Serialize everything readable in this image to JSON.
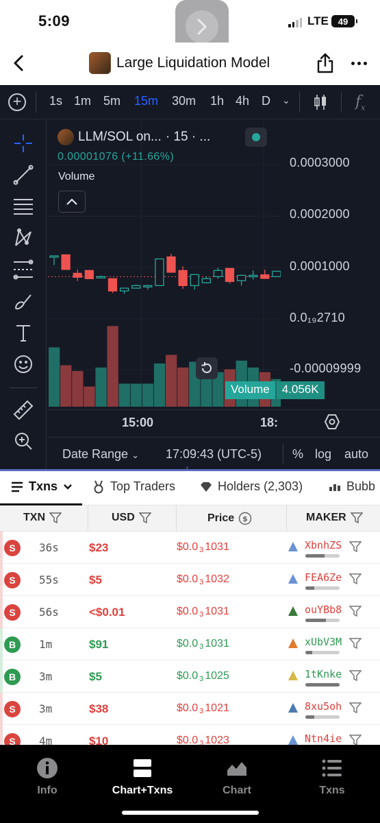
{
  "status": {
    "time": "5:09",
    "network": "LTE",
    "battery": "49"
  },
  "nav": {
    "title": "Large Liquidation Model"
  },
  "chart_toolbar": {
    "timeframes": [
      "1s",
      "1m",
      "5m",
      "15m",
      "30m",
      "1h",
      "4h",
      "D"
    ],
    "active": "15m",
    "fx_label": "f"
  },
  "legend": {
    "symbol": "LLM/SOL on...",
    "interval": "· 15 · ...",
    "price": "0.00001076 (+11.66%)",
    "volume_label": "Volume"
  },
  "price_axis": [
    "0.0003000",
    "0.0002000",
    "0.0001000",
    "0.0₁₉2710",
    "-0.00009999"
  ],
  "volume_tag": {
    "label": "Volume",
    "value": "4.056K"
  },
  "time_axis": [
    "15:00",
    "18:"
  ],
  "chart_bottom": {
    "date_range": "Date Range",
    "clock": "17:09:43 (UTC-5)",
    "percent": "%",
    "log": "log",
    "auto": "auto"
  },
  "colors": {
    "up": "#26a69a",
    "down": "#ef5350",
    "background": "#151924",
    "accent": "#2962ff"
  },
  "chart_data": {
    "type": "candlestick",
    "ylim": [
      -9.999e-05,
      0.0003
    ],
    "candles": [
      {
        "o": 0.000122,
        "h": 0.000122,
        "l": 0.000104,
        "c": 0.000122
      },
      {
        "o": 0.000124,
        "h": 0.000124,
        "l": 9.55e-05,
        "c": 9.55e-05
      },
      {
        "o": 8.8e-05,
        "h": 9.55e-05,
        "l": 7.3e-05,
        "c": 8.02e-05
      },
      {
        "o": 9.35e-05,
        "h": 9.35e-05,
        "l": 7.75e-05,
        "c": 7.75e-05
      },
      {
        "o": 8.15e-05,
        "h": 8.35e-05,
        "l": 8.15e-05,
        "c": 8.15e-05
      },
      {
        "o": 7.75e-05,
        "h": 7.75e-05,
        "l": 4.95e-05,
        "c": 5.35e-05
      },
      {
        "o": 5.35e-05,
        "h": 5.6e-05,
        "l": 4.8e-05,
        "c": 5.9e-05
      },
      {
        "o": 5.9e-05,
        "h": 6.6e-05,
        "l": 5.9e-05,
        "c": 6.4e-05
      },
      {
        "o": 6.4e-05,
        "h": 6.5e-05,
        "l": 5.6e-05,
        "c": 6.4e-05
      },
      {
        "o": 6.4e-05,
        "h": 0.000116,
        "l": 6.4e-05,
        "c": 0.000116
      },
      {
        "o": 0.00012,
        "h": 0.000126,
        "l": 9e-05,
        "c": 9e-05
      },
      {
        "o": 9.35e-05,
        "h": 0.0001015,
        "l": 5.75e-05,
        "c": 6.4e-05
      },
      {
        "o": 6.4e-05,
        "h": 8.55e-05,
        "l": 5.6e-05,
        "c": 8.55e-05
      },
      {
        "o": 6.95e-05,
        "h": 8.15e-05,
        "l": 6.8e-05,
        "c": 7.75e-05
      },
      {
        "o": 8.15e-05,
        "h": 9.9e-05,
        "l": 7.75e-05,
        "c": 9.35e-05
      },
      {
        "o": 9.75e-05,
        "h": 9.75e-05,
        "l": 6.8e-05,
        "c": 7.2e-05
      },
      {
        "o": 7.35e-05,
        "h": 8.55e-05,
        "l": 6.4e-05,
        "c": 8.4e-05
      },
      {
        "o": 8.3e-05,
        "h": 9.35e-05,
        "l": 7.6e-05,
        "c": 8.4e-05
      },
      {
        "o": 8.5e-05,
        "h": 9.5e-05,
        "l": 7.7e-05,
        "c": 7.8e-05
      },
      {
        "o": 8.15e-05,
        "h": 9.2e-05,
        "l": 8.15e-05,
        "c": 9.2e-05
      }
    ],
    "volume": [
      103,
      72,
      62,
      35,
      68,
      140,
      40,
      40,
      40,
      75,
      90,
      68,
      78,
      78,
      60,
      65,
      80,
      68,
      60,
      48
    ]
  },
  "tabs": [
    {
      "label": "Txns",
      "active": true
    },
    {
      "label": "Top Traders"
    },
    {
      "label": "Holders (2,303)"
    },
    {
      "label": "Bubb"
    }
  ],
  "table": {
    "headers": [
      "TXN",
      "USD",
      "Price",
      "MAKER"
    ],
    "rows": [
      {
        "type": "S",
        "age": "36s",
        "usd": "$23",
        "price_a": "$0.0",
        "price_sub": "3",
        "price_b": "1031",
        "maker": "XbnhZS",
        "bar": 0.55,
        "icon": "#6a93d4"
      },
      {
        "type": "S",
        "age": "55s",
        "usd": "$5",
        "price_a": "$0.0",
        "price_sub": "3",
        "price_b": "1032",
        "maker": "FEA6Ze",
        "bar": 0.25,
        "icon": "#6a93d4"
      },
      {
        "type": "S",
        "age": "56s",
        "usd": "<$0.01",
        "price_a": "$0.0",
        "price_sub": "3",
        "price_b": "1031",
        "maker": "ouYBb8",
        "bar": 0.6,
        "icon": "#3b7a3b"
      },
      {
        "type": "B",
        "age": "1m",
        "usd": "$91",
        "price_a": "$0.0",
        "price_sub": "3",
        "price_b": "1031",
        "maker": "xUbV3M",
        "bar": 0.2,
        "icon": "#e07a2e"
      },
      {
        "type": "B",
        "age": "3m",
        "usd": "$5",
        "price_a": "$0.0",
        "price_sub": "3",
        "price_b": "1025",
        "maker": "1tKnke",
        "bar": 1.0,
        "icon": "#d8b84a"
      },
      {
        "type": "S",
        "age": "3m",
        "usd": "$38",
        "price_a": "$0.0",
        "price_sub": "3",
        "price_b": "1021",
        "maker": "8xu5oh",
        "bar": 0.25,
        "icon": "#4a7ab0"
      },
      {
        "type": "S",
        "age": "4m",
        "usd": "$10",
        "price_a": "$0.0",
        "price_sub": "3",
        "price_b": "1023",
        "maker": "Ntn4ie",
        "bar": 0.3,
        "icon": "#6a93d4"
      }
    ]
  },
  "bottom_nav": [
    {
      "label": "Info"
    },
    {
      "label": "Chart+Txns",
      "active": true
    },
    {
      "label": "Chart"
    },
    {
      "label": "Txns"
    }
  ]
}
